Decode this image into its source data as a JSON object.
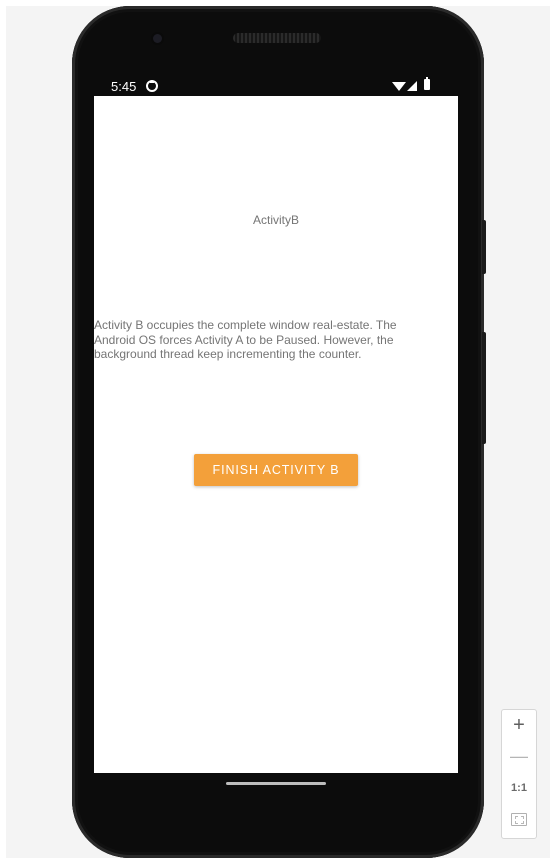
{
  "status_bar": {
    "time": "5:45",
    "icons": [
      "sync-icon",
      "wifi-icon",
      "signal-icon",
      "battery-icon"
    ]
  },
  "activity": {
    "title": "ActivityB",
    "description": "Activity B occupies the complete window real-estate. The Android OS forces Activity A to be Paused. However, the background thread keep incrementing the counter.",
    "finish_button_label": "FINISH ACTIVITY B"
  },
  "zoom_controls": {
    "zoom_in_label": "+",
    "zoom_out_label": "—",
    "reset_label": "1:1",
    "fit_icon": "fit-screen-icon"
  },
  "colors": {
    "button_accent": "#f3a03a",
    "text_gray": "#757575",
    "phone_frame": "#0c0c0c"
  }
}
